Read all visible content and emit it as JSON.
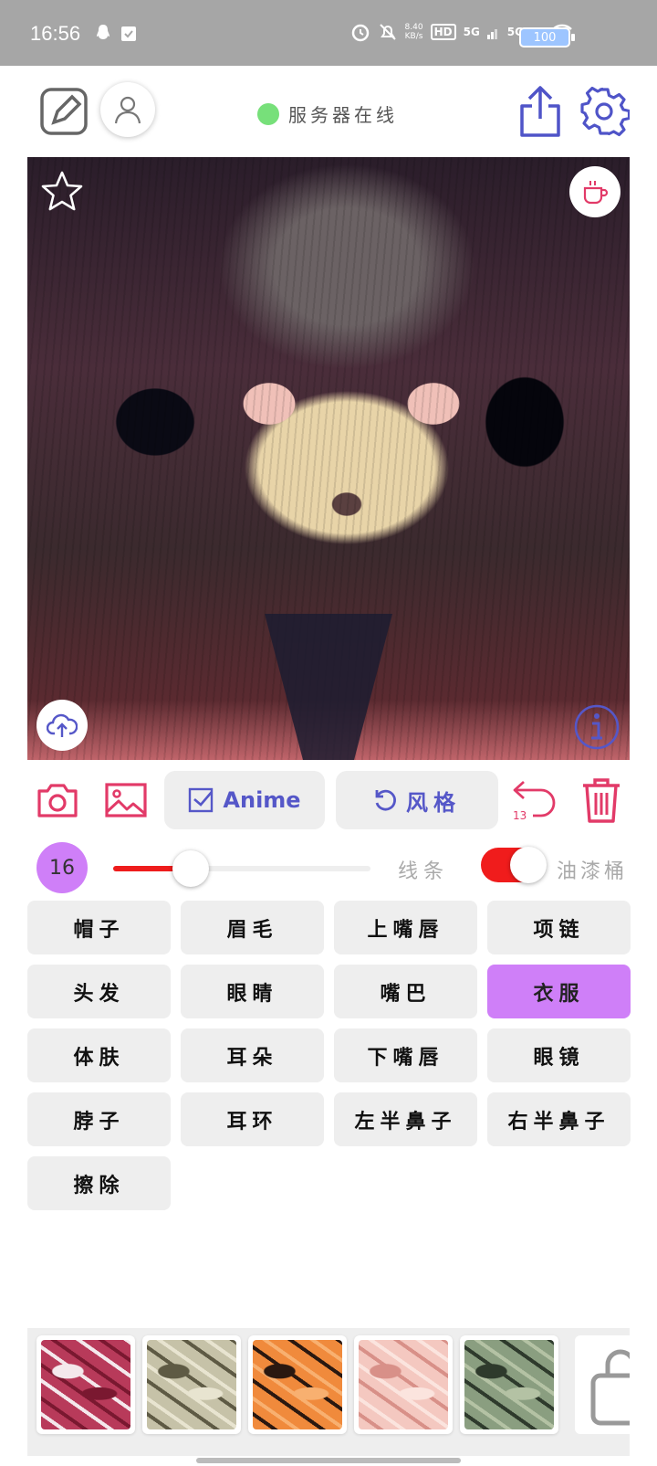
{
  "status_bar": {
    "time": "16:56",
    "net_speed_value": "8.40",
    "net_speed_unit": "KB/s",
    "hd_label": "HD",
    "sim1": "5G",
    "sim2": "5G",
    "battery": "100"
  },
  "header": {
    "server_status": "服务器在线",
    "server_status_color": "#77e07a"
  },
  "toolbar": {
    "anime_label": "Anime",
    "style_label": "风格",
    "undo_count": "13"
  },
  "brush": {
    "size": "16",
    "size_fraction": 0.3,
    "line_label": "线条",
    "bucket_label": "油漆桶",
    "bucket_enabled": true
  },
  "parts": [
    {
      "label": "帽子",
      "active": false
    },
    {
      "label": "眉毛",
      "active": false
    },
    {
      "label": "上嘴唇",
      "active": false
    },
    {
      "label": "项链",
      "active": false
    },
    {
      "label": "头发",
      "active": false
    },
    {
      "label": "眼睛",
      "active": false
    },
    {
      "label": "嘴巴",
      "active": false
    },
    {
      "label": "衣服",
      "active": true
    },
    {
      "label": "体肤",
      "active": false
    },
    {
      "label": "耳朵",
      "active": false
    },
    {
      "label": "下嘴唇",
      "active": false
    },
    {
      "label": "眼镜",
      "active": false
    },
    {
      "label": "脖子",
      "active": false
    },
    {
      "label": "耳环",
      "active": false
    },
    {
      "label": "左半鼻子",
      "active": false
    },
    {
      "label": "右半鼻子",
      "active": false
    },
    {
      "label": "擦除",
      "active": false
    }
  ],
  "palette": {
    "swatches": [
      {
        "name": "crimson-texture",
        "colors": [
          "#b83a5a",
          "#f4e8ec",
          "#7a1830"
        ]
      },
      {
        "name": "olive-texture",
        "colors": [
          "#c6c2a8",
          "#5e5a44",
          "#e8e4d0"
        ]
      },
      {
        "name": "orange-texture",
        "colors": [
          "#f08a3c",
          "#2a1810",
          "#f8b070"
        ]
      },
      {
        "name": "blush-texture",
        "colors": [
          "#f4c8c0",
          "#d89088",
          "#fbe4de"
        ]
      },
      {
        "name": "sage-texture",
        "colors": [
          "#8a9e80",
          "#2e3a2c",
          "#b4c2a4"
        ]
      }
    ],
    "more_icon": "lock-icon"
  },
  "colors": {
    "accent_purple": "#cf7ff8",
    "icon_pink": "#e23a68",
    "icon_indigo": "#5557c8",
    "slider_red": "#ee1c1c"
  }
}
